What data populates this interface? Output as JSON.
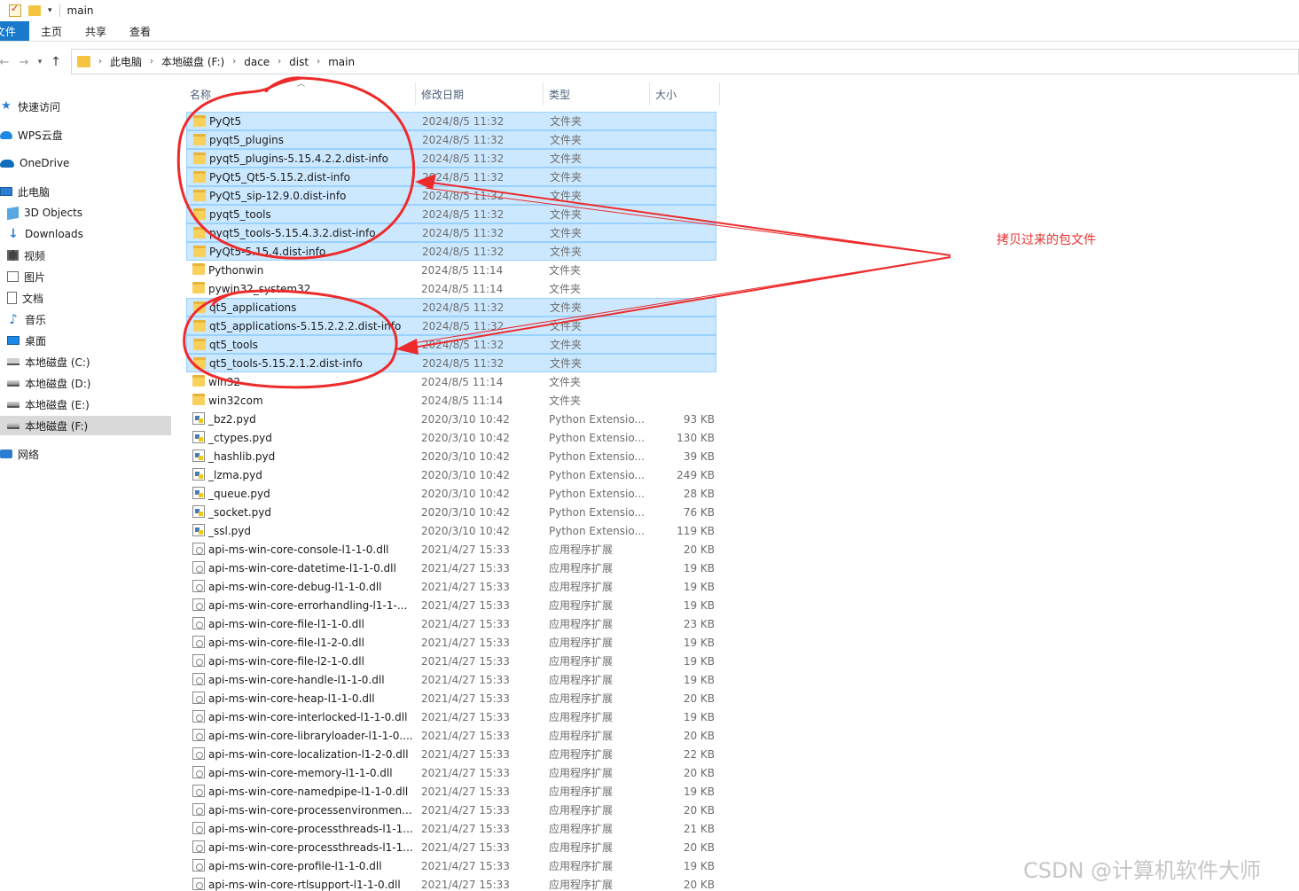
{
  "window": {
    "title": "main"
  },
  "ribbon": {
    "tabs": [
      "文件",
      "主页",
      "共享",
      "查看"
    ]
  },
  "address": {
    "breadcrumbs": [
      "此电脑",
      "本地磁盘 (F:)",
      "dace",
      "dist",
      "main"
    ]
  },
  "sidebar": {
    "items": [
      {
        "label": "快速访问",
        "icon": "star-icon"
      },
      {
        "label": "WPS云盘",
        "icon": "cloud-icon"
      },
      {
        "label": "OneDrive",
        "icon": "onedrive-icon"
      },
      {
        "label": "此电脑",
        "icon": "computer-icon"
      },
      {
        "label": "3D Objects",
        "icon": "3d-objects-icon"
      },
      {
        "label": "Downloads",
        "icon": "downloads-icon"
      },
      {
        "label": "视频",
        "icon": "video-icon"
      },
      {
        "label": "图片",
        "icon": "pictures-icon"
      },
      {
        "label": "文档",
        "icon": "documents-icon"
      },
      {
        "label": "音乐",
        "icon": "music-icon"
      },
      {
        "label": "桌面",
        "icon": "desktop-icon"
      },
      {
        "label": "本地磁盘 (C:)",
        "icon": "drive-icon"
      },
      {
        "label": "本地磁盘 (D:)",
        "icon": "drive-icon"
      },
      {
        "label": "本地磁盘 (E:)",
        "icon": "drive-icon"
      },
      {
        "label": "本地磁盘 (F:)",
        "icon": "drive-icon",
        "selected": true
      },
      {
        "label": "网络",
        "icon": "network-icon"
      }
    ]
  },
  "columns": {
    "name": "名称",
    "date": "修改日期",
    "type": "类型",
    "size": "大小"
  },
  "files": [
    {
      "name": "PyQt5",
      "date": "2024/8/5 11:32",
      "type": "文件夹",
      "size": "",
      "kind": "folder",
      "selected": true
    },
    {
      "name": "pyqt5_plugins",
      "date": "2024/8/5 11:32",
      "type": "文件夹",
      "size": "",
      "kind": "folder",
      "selected": true
    },
    {
      "name": "pyqt5_plugins-5.15.4.2.2.dist-info",
      "date": "2024/8/5 11:32",
      "type": "文件夹",
      "size": "",
      "kind": "folder",
      "selected": true
    },
    {
      "name": "PyQt5_Qt5-5.15.2.dist-info",
      "date": "2024/8/5 11:32",
      "type": "文件夹",
      "size": "",
      "kind": "folder",
      "selected": true
    },
    {
      "name": "PyQt5_sip-12.9.0.dist-info",
      "date": "2024/8/5 11:32",
      "type": "文件夹",
      "size": "",
      "kind": "folder",
      "selected": true
    },
    {
      "name": "pyqt5_tools",
      "date": "2024/8/5 11:32",
      "type": "文件夹",
      "size": "",
      "kind": "folder",
      "selected": true
    },
    {
      "name": "pyqt5_tools-5.15.4.3.2.dist-info",
      "date": "2024/8/5 11:32",
      "type": "文件夹",
      "size": "",
      "kind": "folder",
      "selected": true
    },
    {
      "name": "PyQt5-5.15.4.dist-info",
      "date": "2024/8/5 11:32",
      "type": "文件夹",
      "size": "",
      "kind": "folder",
      "selected": true
    },
    {
      "name": "Pythonwin",
      "date": "2024/8/5 11:14",
      "type": "文件夹",
      "size": "",
      "kind": "folder",
      "selected": false
    },
    {
      "name": "pywin32_system32",
      "date": "2024/8/5 11:14",
      "type": "文件夹",
      "size": "",
      "kind": "folder",
      "selected": false
    },
    {
      "name": "qt5_applications",
      "date": "2024/8/5 11:32",
      "type": "文件夹",
      "size": "",
      "kind": "folder",
      "selected": true
    },
    {
      "name": "qt5_applications-5.15.2.2.2.dist-info",
      "date": "2024/8/5 11:32",
      "type": "文件夹",
      "size": "",
      "kind": "folder",
      "selected": true
    },
    {
      "name": "qt5_tools",
      "date": "2024/8/5 11:32",
      "type": "文件夹",
      "size": "",
      "kind": "folder",
      "selected": true
    },
    {
      "name": "qt5_tools-5.15.2.1.2.dist-info",
      "date": "2024/8/5 11:32",
      "type": "文件夹",
      "size": "",
      "kind": "folder",
      "selected": true
    },
    {
      "name": "win32",
      "date": "2024/8/5 11:14",
      "type": "文件夹",
      "size": "",
      "kind": "folder",
      "selected": false
    },
    {
      "name": "win32com",
      "date": "2024/8/5 11:14",
      "type": "文件夹",
      "size": "",
      "kind": "folder",
      "selected": false
    },
    {
      "name": "_bz2.pyd",
      "date": "2020/3/10 10:42",
      "type": "Python Extensio...",
      "size": "93 KB",
      "kind": "pyd",
      "selected": false
    },
    {
      "name": "_ctypes.pyd",
      "date": "2020/3/10 10:42",
      "type": "Python Extensio...",
      "size": "130 KB",
      "kind": "pyd",
      "selected": false
    },
    {
      "name": "_hashlib.pyd",
      "date": "2020/3/10 10:42",
      "type": "Python Extensio...",
      "size": "39 KB",
      "kind": "pyd",
      "selected": false
    },
    {
      "name": "_lzma.pyd",
      "date": "2020/3/10 10:42",
      "type": "Python Extensio...",
      "size": "249 KB",
      "kind": "pyd",
      "selected": false
    },
    {
      "name": "_queue.pyd",
      "date": "2020/3/10 10:42",
      "type": "Python Extensio...",
      "size": "28 KB",
      "kind": "pyd",
      "selected": false
    },
    {
      "name": "_socket.pyd",
      "date": "2020/3/10 10:42",
      "type": "Python Extensio...",
      "size": "76 KB",
      "kind": "pyd",
      "selected": false
    },
    {
      "name": "_ssl.pyd",
      "date": "2020/3/10 10:42",
      "type": "Python Extensio...",
      "size": "119 KB",
      "kind": "pyd",
      "selected": false
    },
    {
      "name": "api-ms-win-core-console-l1-1-0.dll",
      "date": "2021/4/27 15:33",
      "type": "应用程序扩展",
      "size": "20 KB",
      "kind": "dll",
      "selected": false
    },
    {
      "name": "api-ms-win-core-datetime-l1-1-0.dll",
      "date": "2021/4/27 15:33",
      "type": "应用程序扩展",
      "size": "19 KB",
      "kind": "dll",
      "selected": false
    },
    {
      "name": "api-ms-win-core-debug-l1-1-0.dll",
      "date": "2021/4/27 15:33",
      "type": "应用程序扩展",
      "size": "19 KB",
      "kind": "dll",
      "selected": false
    },
    {
      "name": "api-ms-win-core-errorhandling-l1-1-...",
      "date": "2021/4/27 15:33",
      "type": "应用程序扩展",
      "size": "19 KB",
      "kind": "dll",
      "selected": false
    },
    {
      "name": "api-ms-win-core-file-l1-1-0.dll",
      "date": "2021/4/27 15:33",
      "type": "应用程序扩展",
      "size": "23 KB",
      "kind": "dll",
      "selected": false
    },
    {
      "name": "api-ms-win-core-file-l1-2-0.dll",
      "date": "2021/4/27 15:33",
      "type": "应用程序扩展",
      "size": "19 KB",
      "kind": "dll",
      "selected": false
    },
    {
      "name": "api-ms-win-core-file-l2-1-0.dll",
      "date": "2021/4/27 15:33",
      "type": "应用程序扩展",
      "size": "19 KB",
      "kind": "dll",
      "selected": false
    },
    {
      "name": "api-ms-win-core-handle-l1-1-0.dll",
      "date": "2021/4/27 15:33",
      "type": "应用程序扩展",
      "size": "19 KB",
      "kind": "dll",
      "selected": false
    },
    {
      "name": "api-ms-win-core-heap-l1-1-0.dll",
      "date": "2021/4/27 15:33",
      "type": "应用程序扩展",
      "size": "20 KB",
      "kind": "dll",
      "selected": false
    },
    {
      "name": "api-ms-win-core-interlocked-l1-1-0.dll",
      "date": "2021/4/27 15:33",
      "type": "应用程序扩展",
      "size": "19 KB",
      "kind": "dll",
      "selected": false
    },
    {
      "name": "api-ms-win-core-libraryloader-l1-1-0....",
      "date": "2021/4/27 15:33",
      "type": "应用程序扩展",
      "size": "20 KB",
      "kind": "dll",
      "selected": false
    },
    {
      "name": "api-ms-win-core-localization-l1-2-0.dll",
      "date": "2021/4/27 15:33",
      "type": "应用程序扩展",
      "size": "22 KB",
      "kind": "dll",
      "selected": false
    },
    {
      "name": "api-ms-win-core-memory-l1-1-0.dll",
      "date": "2021/4/27 15:33",
      "type": "应用程序扩展",
      "size": "20 KB",
      "kind": "dll",
      "selected": false
    },
    {
      "name": "api-ms-win-core-namedpipe-l1-1-0.dll",
      "date": "2021/4/27 15:33",
      "type": "应用程序扩展",
      "size": "19 KB",
      "kind": "dll",
      "selected": false
    },
    {
      "name": "api-ms-win-core-processenvironmen...",
      "date": "2021/4/27 15:33",
      "type": "应用程序扩展",
      "size": "20 KB",
      "kind": "dll",
      "selected": false
    },
    {
      "name": "api-ms-win-core-processthreads-l1-1...",
      "date": "2021/4/27 15:33",
      "type": "应用程序扩展",
      "size": "21 KB",
      "kind": "dll",
      "selected": false
    },
    {
      "name": "api-ms-win-core-processthreads-l1-1...",
      "date": "2021/4/27 15:33",
      "type": "应用程序扩展",
      "size": "20 KB",
      "kind": "dll",
      "selected": false
    },
    {
      "name": "api-ms-win-core-profile-l1-1-0.dll",
      "date": "2021/4/27 15:33",
      "type": "应用程序扩展",
      "size": "19 KB",
      "kind": "dll",
      "selected": false
    },
    {
      "name": "api-ms-win-core-rtlsupport-l1-1-0.dll",
      "date": "2021/4/27 15:33",
      "type": "应用程序扩展",
      "size": "20 KB",
      "kind": "dll",
      "selected": false
    }
  ],
  "annotation": {
    "text": "拷贝过来的包文件",
    "color": "#e8312f"
  },
  "watermark": "CSDN @计算机软件大师",
  "colors": {
    "accent": "#1979ca",
    "selection": "#cce8ff",
    "folder": "#f8d15c"
  }
}
